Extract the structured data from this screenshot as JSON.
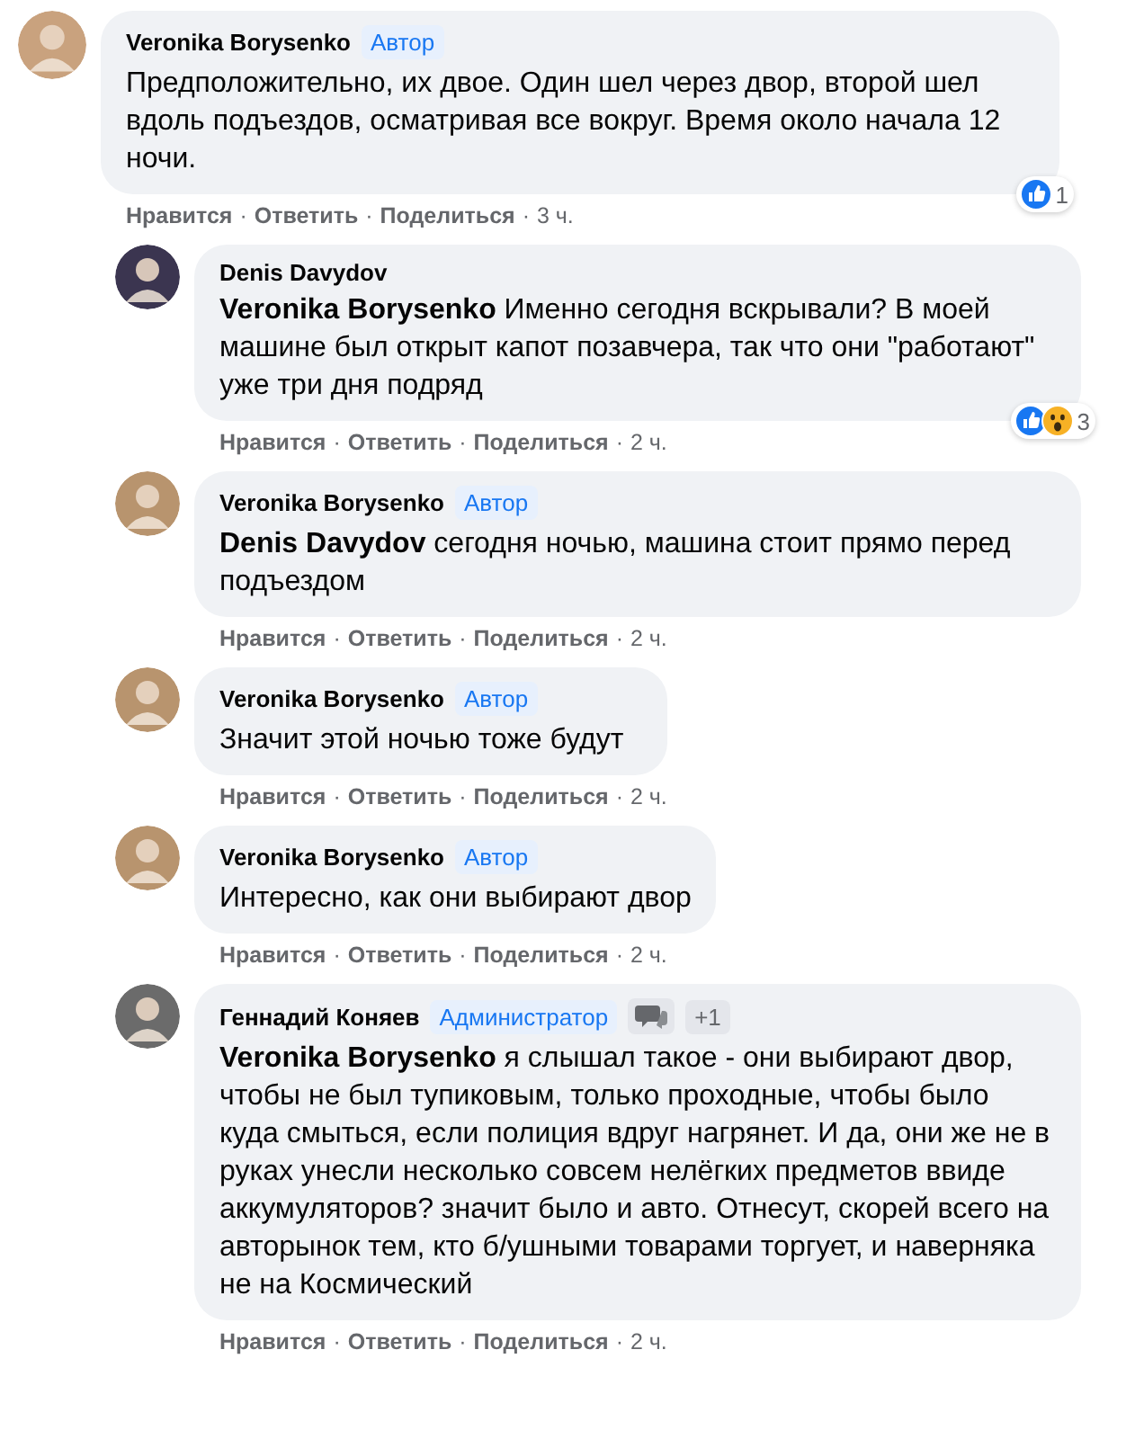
{
  "comment": {
    "author": "Veronika Borysenko",
    "badges": [
      {
        "kind": "role",
        "text": "Автор"
      }
    ],
    "text": "Предположительно, их двое. Один шел через двор, второй шел вдоль подъездов, осматривая все вокруг. Время около начала 12 ночи.",
    "actions": [
      {
        "kind": "link",
        "text": "Нравится"
      },
      {
        "kind": "separator",
        "text": "·"
      },
      {
        "kind": "link",
        "text": "Ответить"
      },
      {
        "kind": "separator",
        "text": "·"
      },
      {
        "kind": "link",
        "text": "Поделиться"
      },
      {
        "kind": "separator",
        "text": "·"
      }
    ],
    "time": "3 ч.",
    "reactions": {
      "kinds": [
        {
          "kind": "like"
        }
      ],
      "count": "1"
    },
    "replies": [
      {
        "author": "Denis Davydov",
        "mention": "Veronika Borysenko",
        "text": "Именно сегодня вскрывали? В моей машине был открыт капот позавчера, так что они \"работают\" уже три дня подряд",
        "actions": [
          {
            "kind": "link",
            "text": "Нравится"
          },
          {
            "kind": "separator",
            "text": "·"
          },
          {
            "kind": "link",
            "text": "Ответить"
          },
          {
            "kind": "separator",
            "text": "·"
          },
          {
            "kind": "link",
            "text": "Поделиться"
          },
          {
            "kind": "separator",
            "text": "·"
          }
        ],
        "time": "2 ч.",
        "reactions": {
          "kinds": [
            {
              "kind": "like"
            },
            {
              "kind": "wow"
            }
          ],
          "count": "3"
        }
      },
      {
        "author": "Veronika Borysenko",
        "badges": [
          {
            "kind": "role",
            "text": "Автор"
          }
        ],
        "mention": "Denis Davydov",
        "text": "сегодня ночью, машина стоит прямо перед подъездом",
        "actions": [
          {
            "kind": "link",
            "text": "Нравится"
          },
          {
            "kind": "separator",
            "text": "·"
          },
          {
            "kind": "link",
            "text": "Ответить"
          },
          {
            "kind": "separator",
            "text": "·"
          },
          {
            "kind": "link",
            "text": "Поделиться"
          },
          {
            "kind": "separator",
            "text": "·"
          }
        ],
        "time": "2 ч."
      },
      {
        "author": "Veronika Borysenko",
        "badges": [
          {
            "kind": "role",
            "text": "Автор"
          }
        ],
        "text": "Значит этой ночью тоже будут",
        "actions": [
          {
            "kind": "link",
            "text": "Нравится"
          },
          {
            "kind": "separator",
            "text": "·"
          },
          {
            "kind": "link",
            "text": "Ответить"
          },
          {
            "kind": "separator",
            "text": "·"
          },
          {
            "kind": "link",
            "text": "Поделиться"
          },
          {
            "kind": "separator",
            "text": "·"
          }
        ],
        "time": "2 ч."
      },
      {
        "author": "Veronika Borysenko",
        "badges": [
          {
            "kind": "role",
            "text": "Автор"
          }
        ],
        "text": "Интересно, как они выбирают двор",
        "actions": [
          {
            "kind": "link",
            "text": "Нравится"
          },
          {
            "kind": "separator",
            "text": "·"
          },
          {
            "kind": "link",
            "text": "Ответить"
          },
          {
            "kind": "separator",
            "text": "·"
          },
          {
            "kind": "link",
            "text": "Поделиться"
          },
          {
            "kind": "separator",
            "text": "·"
          }
        ],
        "time": "2 ч."
      },
      {
        "author": "Геннадий Коняев",
        "badges": [
          {
            "kind": "role",
            "text": "Администратор"
          },
          {
            "kind": "chat"
          },
          {
            "kind": "count",
            "text": "+1"
          }
        ],
        "mention": "Veronika Borysenko",
        "text": "я слышал такое - они выбирают двор, чтобы не был тупиковым, только проходные, чтобы было куда смыться, если полиция вдруг нагрянет. И да, они же не в руках унесли несколько совсем нелёгких предметов ввиде аккумуляторов? значит было и авто. Отнесут, скорей всего на авторынок тем, кто б/ушными товарами торгует, и наверняка не на Космический",
        "actions": [
          {
            "kind": "link",
            "text": "Нравится"
          },
          {
            "kind": "separator",
            "text": "·"
          },
          {
            "kind": "link",
            "text": "Ответить"
          },
          {
            "kind": "separator",
            "text": "·"
          },
          {
            "kind": "link",
            "text": "Поделиться"
          },
          {
            "kind": "separator",
            "text": "·"
          }
        ],
        "time": "2 ч."
      }
    ]
  }
}
